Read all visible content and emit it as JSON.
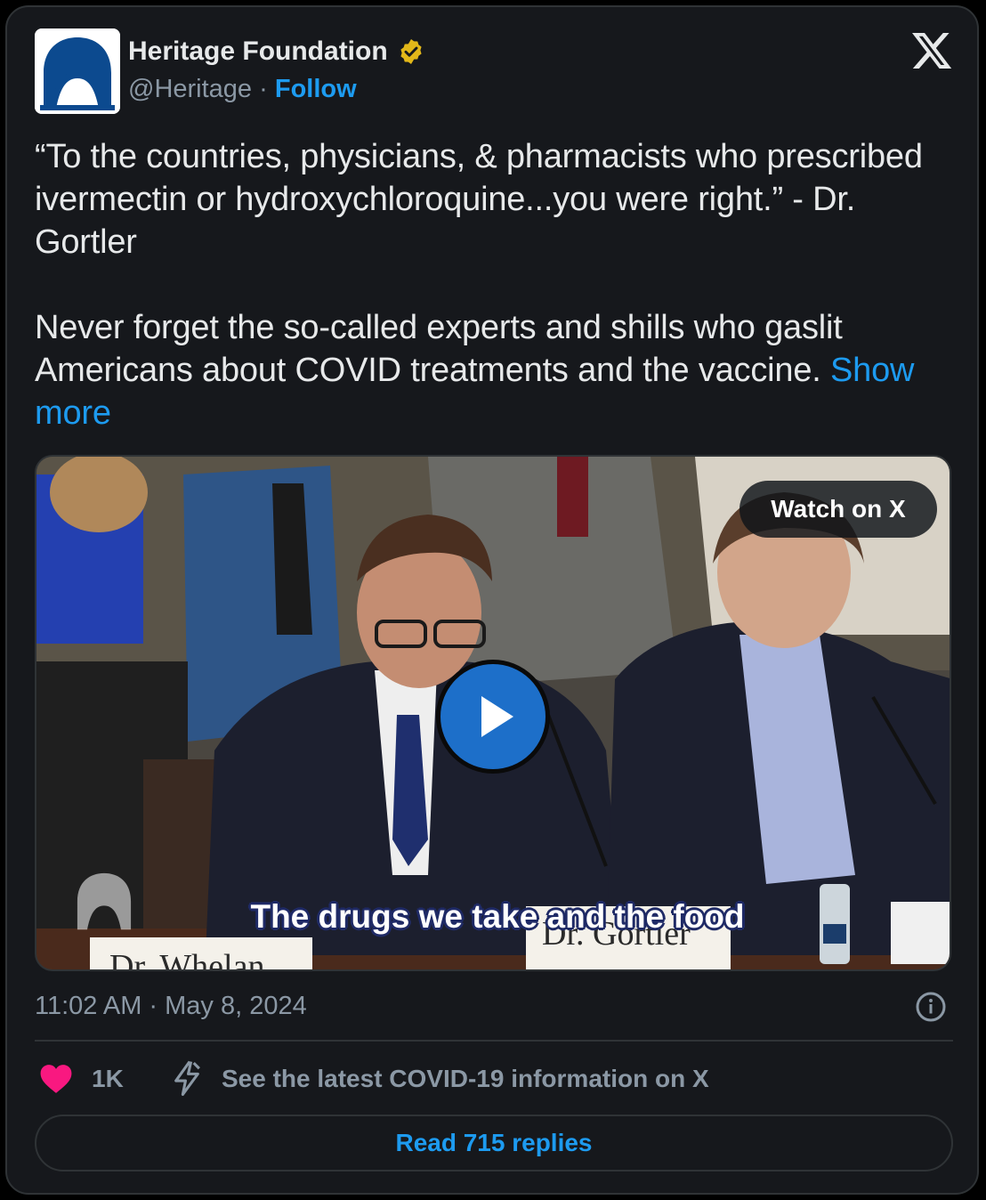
{
  "author": {
    "name": "Heritage Foundation",
    "handle": "@Heritage",
    "separator": "·",
    "follow_label": "Follow",
    "verified": true,
    "verified_color": "#e2b719"
  },
  "tweet": {
    "paragraph_1": "“To the countries, physicians, & pharmacists who prescribed ivermectin or hydroxychloroquine...you were right.” - Dr. Gortler",
    "paragraph_2": "Never forget the so-called experts and shills who gaslit Americans about COVID treatments and the vaccine.",
    "show_more_label": "Show more"
  },
  "media": {
    "watch_label": "Watch on X",
    "caption": "The drugs we take and the food",
    "nameplate_left": "Dr. Whelan",
    "nameplate_center": "Dr. Gortler"
  },
  "meta": {
    "timestamp": "11:02 AM · May 8, 2024"
  },
  "actions": {
    "like_count": "1K",
    "covid_info_label": "See the latest COVID-19 information on X",
    "replies_label": "Read 715 replies"
  },
  "icons": {
    "avatar": "heritage-bell-logo",
    "verified": "verified-badge-icon",
    "close": "x-logo-icon",
    "play": "play-icon",
    "info": "info-icon",
    "like": "heart-icon",
    "covid": "lightning-bolt-icon"
  },
  "colors": {
    "accent": "#1d9bf0",
    "background": "#16181c",
    "like": "#f91880",
    "heritage_blue": "#0c4a8f"
  }
}
